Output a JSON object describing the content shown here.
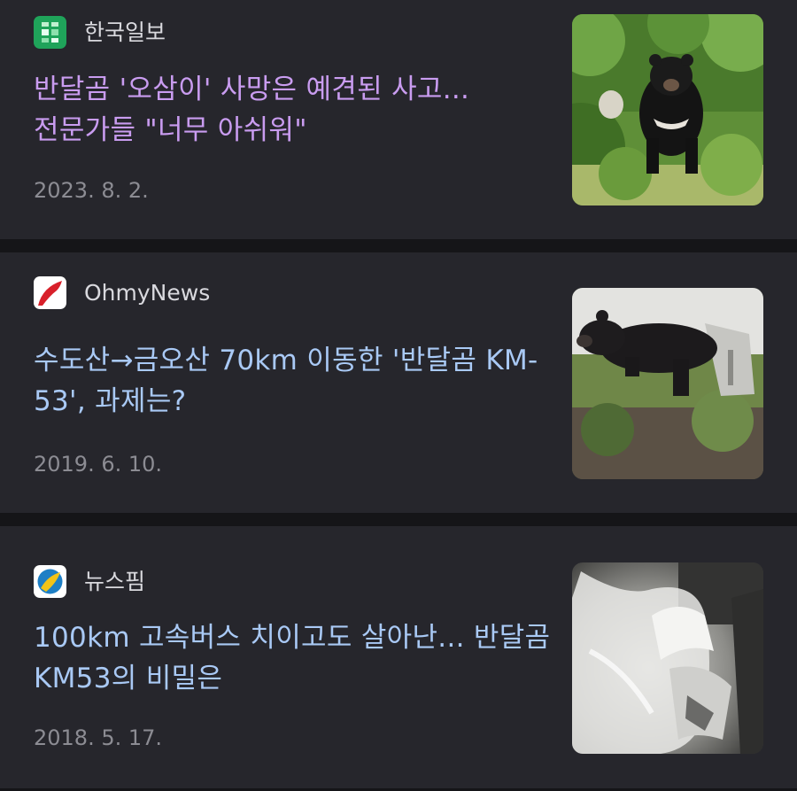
{
  "articles": [
    {
      "source": "한국일보",
      "source_logo": "hankook-ilbo-logo",
      "headline": "반달곰 '오삼이' 사망은 예견된 사고... 전문가들 \"너무 아쉬워\"",
      "date": "2023. 8. 2.",
      "headline_color": "#c99cf0",
      "thumbnail": "black-bear-in-grass-photo"
    },
    {
      "source": "OhmyNews",
      "source_logo": "ohmynews-logo",
      "headline": "수도산→금오산 70km 이동한 '반달곰 KM-53', 과제는?",
      "date": "2019. 6. 10.",
      "headline_color": "#a9c9f5",
      "thumbnail": "bear-leaving-cage-photo"
    },
    {
      "source": "뉴스핌",
      "source_logo": "newspim-logo",
      "headline": "100km 고속버스 치이고도 살아난... 반달곰 KM53의 비밀은",
      "date": "2018. 5. 17.",
      "headline_color": "#a9c9f5",
      "thumbnail": "bone-xray-photo"
    }
  ]
}
